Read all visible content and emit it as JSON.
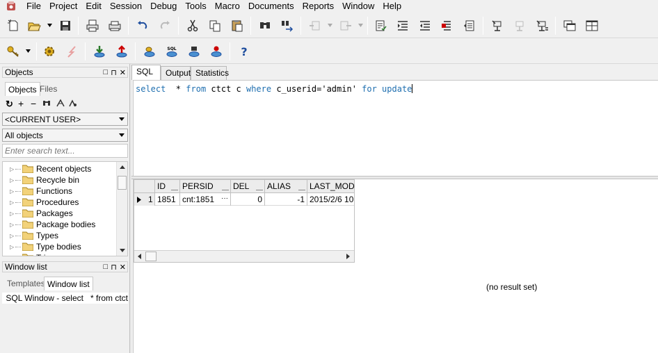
{
  "menu": [
    "File",
    "Project",
    "Edit",
    "Session",
    "Debug",
    "Tools",
    "Macro",
    "Documents",
    "Reports",
    "Window",
    "Help"
  ],
  "objects_panel": {
    "title": "Objects",
    "tabs": [
      "Objects",
      "Files"
    ],
    "user_combo": "<CURRENT USER>",
    "filter_combo": "All objects",
    "search_placeholder": "Enter search text...",
    "tree": [
      "Recent objects",
      "Recycle bin",
      "Functions",
      "Procedures",
      "Packages",
      "Package bodies",
      "Types",
      "Type bodies",
      "Triggers"
    ]
  },
  "window_list_panel": {
    "title": "Window list",
    "tabs": [
      "Templates",
      "Window list"
    ],
    "item": "SQL Window - select   * from ctct"
  },
  "main_tabs": [
    "SQL",
    "Output",
    "Statistics"
  ],
  "editor": {
    "sql": {
      "kw1": "select",
      "star": "  * ",
      "kw2": "from",
      "t1": " ctct c ",
      "kw3": "where",
      "t2": " c_userid=",
      "str": "'admin'",
      "t3": " ",
      "kw4": "for update"
    }
  },
  "result_grid": {
    "columns": [
      "ID",
      "PERSID",
      "DEL",
      "ALIAS",
      "LAST_MOD"
    ],
    "row_number": "1",
    "row": [
      "1851",
      "cnt:1851",
      "0",
      "-1",
      "2015/2/6 10"
    ],
    "ellipsis": "···"
  },
  "no_result": "(no result set)",
  "panel_controls": {
    "pin": "□",
    "float": "⊓",
    "close": "✕"
  }
}
